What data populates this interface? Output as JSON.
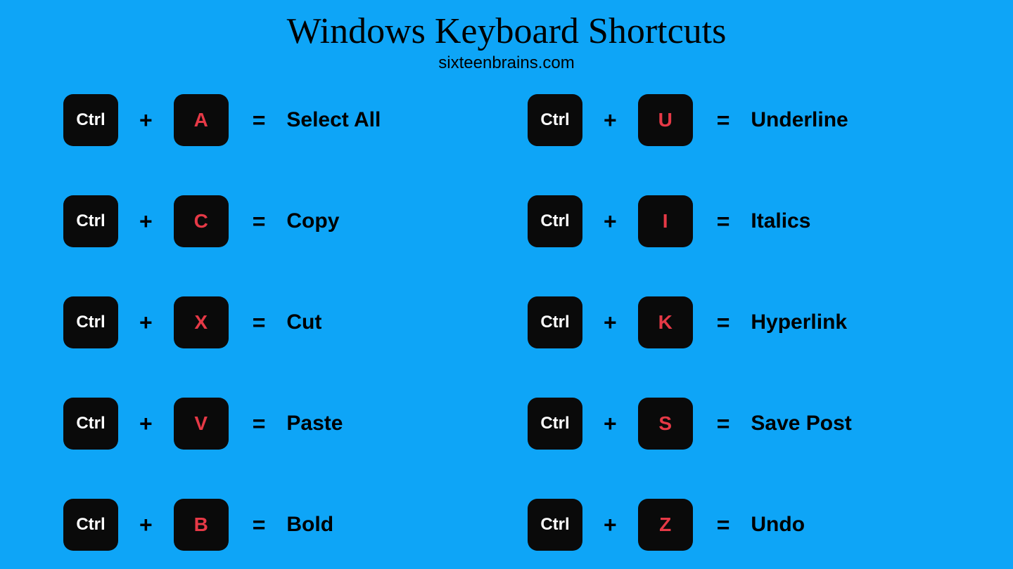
{
  "title": "Windows Keyboard Shortcuts",
  "subtitle": "sixteenbrains.com",
  "ctrlLabel": "Ctrl",
  "plusSymbol": "+",
  "equalsSymbol": "=",
  "shortcuts": [
    {
      "key": "A",
      "desc": "Select All"
    },
    {
      "key": "U",
      "desc": "Underline"
    },
    {
      "key": "C",
      "desc": "Copy"
    },
    {
      "key": "I",
      "desc": "Italics"
    },
    {
      "key": "X",
      "desc": "Cut"
    },
    {
      "key": "K",
      "desc": "Hyperlink"
    },
    {
      "key": "V",
      "desc": "Paste"
    },
    {
      "key": "S",
      "desc": "Save Post"
    },
    {
      "key": "B",
      "desc": "Bold"
    },
    {
      "key": "Z",
      "desc": "Undo"
    }
  ]
}
